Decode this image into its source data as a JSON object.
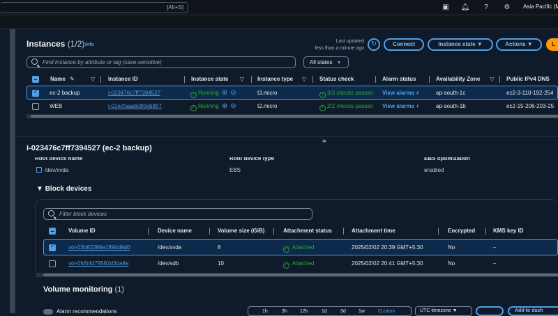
{
  "topbar": {
    "search_shortcut": "[Alt+S]",
    "region": "Asia Pacific (Mu"
  },
  "instances": {
    "title": "Instances",
    "count": "(1/2)",
    "info": "Info",
    "last_updated_line1": "Last updated",
    "last_updated_line2": "less than a minute ago",
    "connect": "Connect",
    "instance_state": "Instance state ▼",
    "actions": "Actions ▼",
    "launch": "L",
    "filter_placeholder": "Find Instance by attribute or tag (case-sensitive)",
    "states_select": "All states",
    "headers": [
      "Name",
      "Instance ID",
      "Instance state",
      "Instance type",
      "Status check",
      "Alarm status",
      "Availability Zone",
      "Public IPv4 DNS"
    ],
    "rows": [
      {
        "selected": true,
        "name": "ec-2 backup",
        "id": "i-023476c7ff7394527",
        "state": "Running",
        "type": "t3.micro",
        "status": "3/3 checks passec",
        "alarm": "View alarms +",
        "az": "ap-south-1c",
        "dns": "ec2-3-110-192-254"
      },
      {
        "selected": false,
        "name": "WEB",
        "id": "i-01ecfaaa6c80eb857",
        "state": "Running",
        "type": "t2.micro",
        "status": "2/2 checks passec",
        "alarm": "View alarms +",
        "az": "ap-south-1b",
        "dns": "ec2-15-206-203-25"
      }
    ]
  },
  "details": {
    "title": "i-023476c7ff7394527 (ec-2 backup)",
    "root_device_name_label": "Root device name",
    "root_device_name": "/dev/xvda",
    "root_device_type_label": "Root device type",
    "root_device_type": "EBS",
    "ebs_opt_label": "EBS optimization",
    "ebs_opt": "enabled"
  },
  "block_devices": {
    "title": "Block devices",
    "filter_placeholder": "Filter block devices",
    "headers": [
      "Volume ID",
      "Device name",
      "Volume size (GiB)",
      "Attachment status",
      "Attachment time",
      "Encrypted",
      "KMS key ID"
    ],
    "rows": [
      {
        "selected": true,
        "volume": "vol-03b82286e189dd9d0",
        "device": "/dev/xvda",
        "size": "8",
        "status": "Attached",
        "time": "2025/02/02 20:39 GMT+5:30",
        "encrypted": "No",
        "kms": "–"
      },
      {
        "selected": false,
        "volume": "vol-0fd54d79582d3da9a",
        "device": "/dev/sdb",
        "size": "10",
        "status": "Attached",
        "time": "2025/02/02 20:41 GMT+5:30",
        "encrypted": "No",
        "kms": "–"
      }
    ]
  },
  "monitoring": {
    "title": "Volume monitoring",
    "count": "(1)",
    "alarm_rec": "Alarm recommendations",
    "times": [
      "1h",
      "3h",
      "12h",
      "1d",
      "3d",
      "1w",
      "Custom"
    ],
    "timezone": "UTC timezone ▼",
    "add_to": "Add to dash"
  },
  "colors": {
    "accent": "#539fe5",
    "success": "#29ad32",
    "brand": "#ff9900"
  }
}
